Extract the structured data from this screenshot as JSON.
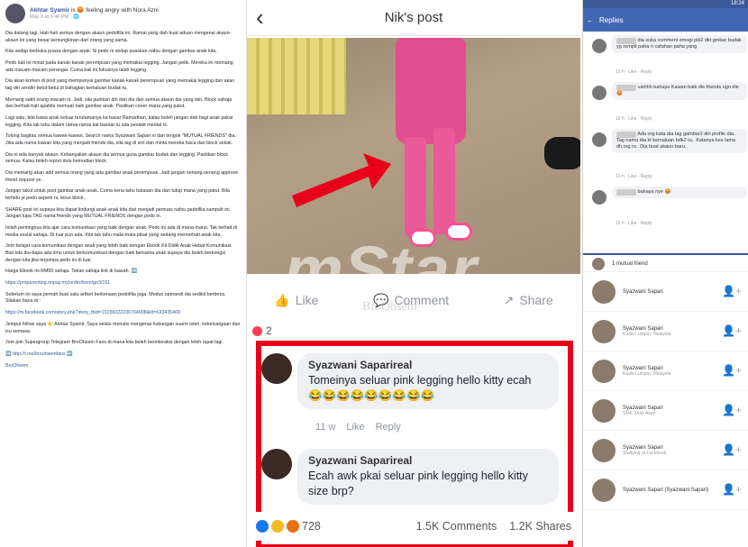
{
  "left_post": {
    "author": "Akhtar Syamir",
    "feeling": "is 😡 feeling angry with Nora Azni",
    "time": "May 9 at 6:46 PM · 🌐",
    "paragraphs": [
      "Dia datang lagi. Hati-hati semua dengan akaun pedofilia ini. Ramai yang dah buat aduan mengenai akaun-akaun ini yang besar kemungkinan dari orang yang sama.",
      "Kita sedap berbuka puasa dengan anak. Si pedo ni sedap puaskan nafsu dengan gambar anak kita.",
      "Pedo kali ini minat pada kanak-kanak perempuan yang memakai legging. Jangan pelik. Mereka ini memang ada macam-macam perangai. Cuma kali ini fokusnya ialah legging.",
      "Dia akan komen di post yang mempunyai gambar kanak-kanak perempuan yang memakai legging dan akan tag diri sendiri betul-betul di bahagian kemaluan budak tu.",
      "Memang sakit orang macam ni. Jadi, sila jauhkan diri dari dia dan semua akaun dia yang lain. Block sahaja dan berhati-hati apabila memuat naik gambar anak. Pastikan cover mana yang patut.",
      "Lagi satu, bila bawa anak keluar terutamanya ke bazar Ramadhan, kalau boleh jangan dah bagi anak pakai legging. Kita tak tahu dalam ramai-ramai kat bazaar tu ada pesakit mental ni.",
      "Tolong bagitau semua kawan-kawan. Search nama Syazwani Sapari ni dan tengok \"MUTUAL FRIENDS\" dia. Jika ada nama kawan kita yang menjadi friends dia, sila tag di sini dan minta mereka baca dan block sekali.",
      "Dia ni ada banyak akaun. Kebanyakan akaun dia semua guna gambar budak dan legging. Pastikan block semua. Kalau boleh report dulu kemudian block.",
      "Dia memang akan add semua orang yang ada gambar anak perempuan. Jadi jangan senang-senang approve friend request ye.",
      "Jangan takut untuk post gambar anak-anak. Cuma kena tahu batasan dia dan tutup mana yang patut. Bila terhidu je pedo seperti ni, terus block.",
      "SHARE post ini supaya kita dapat lindungi anak-anak kita dari menjadi pemuas nafsu pedofilia sampah ini. Jangan lupa TAG nama friends yang MUTUAL FRIENDS dengan pedo ni.",
      "Inilah pentingnya kita ajar cara komunikasi yang baik dengan anak. Pedo ini ada di mana-mana. Tak terhad di media sosial sahaja. Di luar pun ada. Kita tak tahu mata-mata jahat yang sedang memerhati anak kita.",
      "Jom belajar cara komunikasi dengan anak yang lebih baik dengan Ebook Kit Didik Anak Hebat Komunikasi. Biar kita ibu-bapa ada ilmu untuk berkomunikasi dengan baik bersama anak supaya dia boleh berkongsi dengan kita jika terjumpa pedo ini di luar.",
      "Harga Ebook ini RM50 sahaja. Tekan sahaja link di bawah. ➡️",
      "https://proparenting.onpay.my/order/form/go3/151",
      "Sebelum ini saya pernah buat satu artikel berkenaan pedofilia juga. Modus operandi dia sedikit berbeza. Silakan baca di :",
      "https://m.facebook.com/story.php?story_fbid=10156022236704908&id=633435469",
      "Jemput follow saya 👉 Akhtar Syamir. Saya selalu menulis mengenai hubungan suami isteri, kekeluargaan dan isu semasa.",
      "Jom join Supergroup Telegram BroOhsem Fans di mana kita boleh berinteraksi dengan lebih rapat lagi.",
      "➡️ http://t.me/broohsemfans ⬅️",
      "BroOhsem"
    ]
  },
  "mid_post": {
    "title": "Nik's post",
    "actions": {
      "like": "Like",
      "comment": "Comment",
      "share": "Share"
    },
    "reaction_small": "2",
    "comments": [
      {
        "name": "Syazwani Saparireal",
        "text": "Tomeinya seluar pink legging hello kitty ecah 😂😂😂😂😂😂😂😂😂",
        "time": "11 w",
        "like": "Like",
        "reply": "Reply"
      },
      {
        "name": "Syazwani Saparireal",
        "text": "Ecah awk pkai seluar pink legging hello kitty size brp?",
        "time": "",
        "like": "",
        "reply": ""
      }
    ],
    "reactions_count": "728",
    "comments_count": "1.5K Comments",
    "shares_count": "1.2K Shares"
  },
  "watermark": {
    "main": "mStar",
    "sub": "BroOhsem"
  },
  "right_panel": {
    "status_time": "18:24",
    "bar_title": "Replies",
    "replies": [
      {
        "text": "dia suka comment emogi pik2 dkt gmbar budak yg rempit paha n cafahan paha yang",
        "meta": "10 h · Like · Reply"
      },
      {
        "text": "uishhh bahaye Kawan baik die friends ngn die 😡",
        "meta": "10 h · Like · Reply"
      },
      {
        "text": "Ada org kata dia tag gambar2 diri profile dia.. Tag nama dia kt kemaluan bdk2 tu.. Katanya kes lama dh.org rs.. Dia buat akaun baru.",
        "meta": "10 h · Like · Reply"
      },
      {
        "text": "bahaya nye 😡",
        "meta": "10 h · Like · Reply"
      }
    ],
    "list": [
      {
        "name": "1 mutual friend",
        "sub": "Kuala Lumpur"
      },
      {
        "name": "Syazwani Sapari",
        "sub": ""
      },
      {
        "name": "Syazwani Sapari",
        "sub": "Kuala Lumpur, Malaysia"
      },
      {
        "name": "Syazwani Sapari",
        "sub": "Kuala Lumpur, Malaysia"
      },
      {
        "name": "Syazwani Sapari",
        "sub": "SMK Shah Alam"
      },
      {
        "name": "Syazwani Sapari",
        "sub": "Studying at Facebook"
      },
      {
        "name": "Syazwani Sapari (Syazwani Sapari)",
        "sub": ""
      }
    ]
  }
}
